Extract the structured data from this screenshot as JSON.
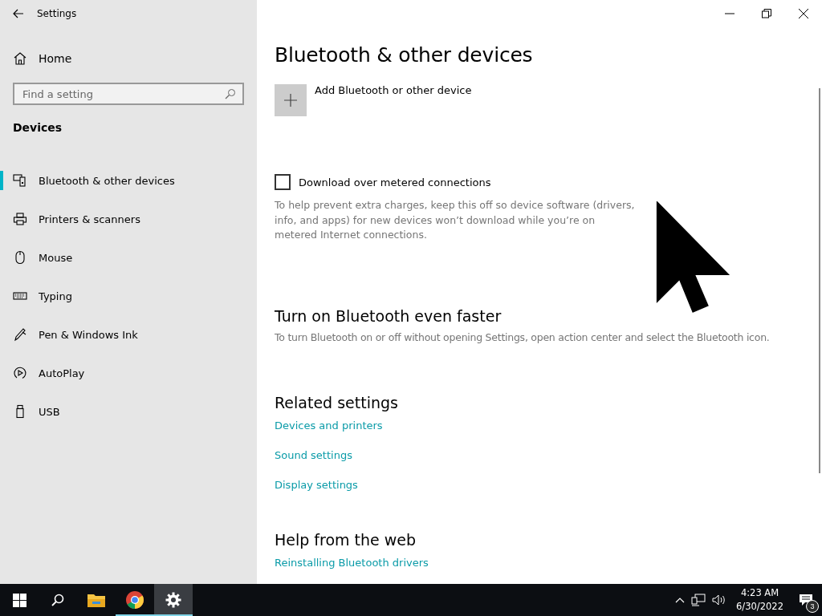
{
  "window": {
    "title": "Settings"
  },
  "sidebar": {
    "home": "Home",
    "search": {
      "placeholder": "Find a setting"
    },
    "section": "Devices",
    "items": [
      {
        "label": "Bluetooth & other devices",
        "selected": true
      },
      {
        "label": "Printers & scanners",
        "selected": false
      },
      {
        "label": "Mouse",
        "selected": false
      },
      {
        "label": "Typing",
        "selected": false
      },
      {
        "label": "Pen & Windows Ink",
        "selected": false
      },
      {
        "label": "AutoPlay",
        "selected": false
      },
      {
        "label": "USB",
        "selected": false
      }
    ]
  },
  "main": {
    "title": "Bluetooth & other devices",
    "add_device": "Add Bluetooth or other device",
    "metered": {
      "label": "Download over metered connections",
      "checked": false,
      "description": "To help prevent extra charges, keep this off so device software (drivers, info, and apps) for new devices won’t download while you’re on metered Internet connections."
    },
    "faster": {
      "heading": "Turn on Bluetooth even faster",
      "text": "To turn Bluetooth on or off without opening Settings, open action center and select the Bluetooth icon."
    },
    "related": {
      "heading": "Related settings",
      "links": [
        "Devices and printers",
        "Sound settings",
        "Display settings"
      ]
    },
    "help": {
      "heading": "Help from the web",
      "links": [
        "Reinstalling Bluetooth drivers"
      ]
    }
  },
  "taskbar": {
    "apps": [
      {
        "active": false,
        "running": false
      },
      {
        "active": false,
        "running": false
      },
      {
        "active": false,
        "running": true
      },
      {
        "active": true,
        "running": true
      }
    ],
    "time": "4:23 AM",
    "date": "6/30/2022",
    "notifications": "3"
  }
}
